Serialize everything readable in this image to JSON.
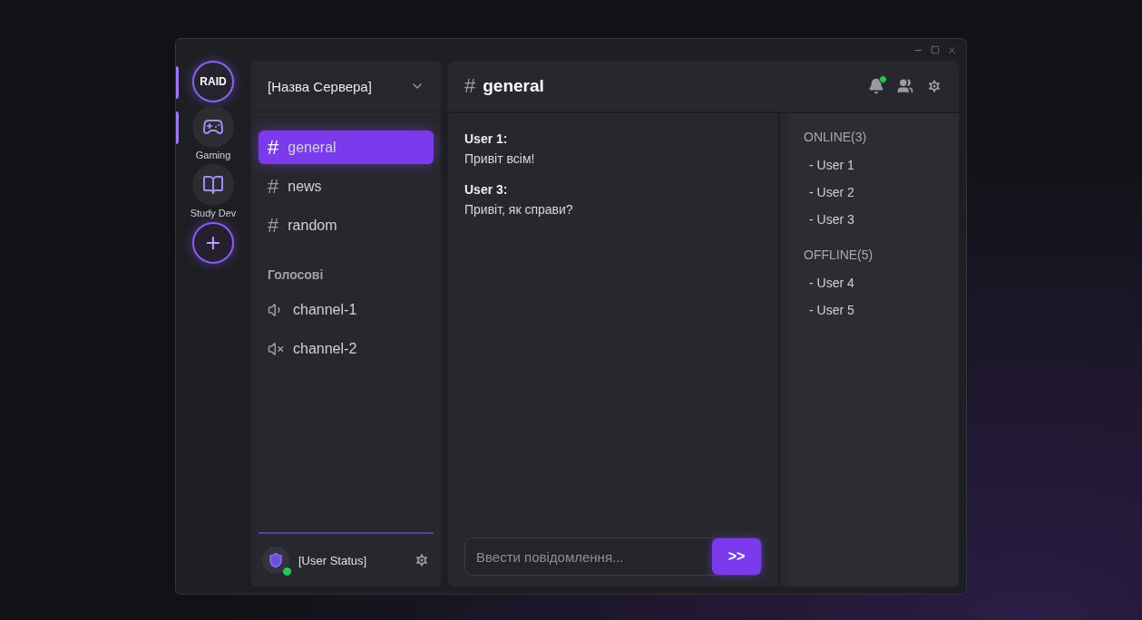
{
  "servers": [
    {
      "kind": "logo",
      "label": "RAID",
      "pill": true
    },
    {
      "kind": "gamepad",
      "label": "Gaming",
      "pill": true
    },
    {
      "kind": "book",
      "label": "Study Dev",
      "pill": false
    },
    {
      "kind": "add",
      "label": "+",
      "pill": false
    }
  ],
  "server_name": "[Назва Сервера]",
  "channels": [
    {
      "kind": "text",
      "symbol": "#",
      "name": "general",
      "selected": true
    },
    {
      "kind": "text",
      "symbol": "#",
      "name": "news",
      "selected": false
    },
    {
      "kind": "text",
      "symbol": "#",
      "name": "random",
      "selected": false
    },
    {
      "kind": "heading",
      "name": "Голосові"
    },
    {
      "kind": "voice",
      "name": "channel-1",
      "muted": false
    },
    {
      "kind": "voice",
      "name": "channel-2",
      "muted": true
    }
  ],
  "user": {
    "status": "[User Status]",
    "online": true
  },
  "header": {
    "symbol": "#",
    "title": "general",
    "notification": true
  },
  "messages": [
    {
      "author": "User 1:",
      "text": "Привіт всім!"
    },
    {
      "author": "User 3:",
      "text": "Привіт, як справи?"
    }
  ],
  "composer": {
    "placeholder": "Ввести повідомлення...",
    "send": ">>"
  },
  "members": [
    {
      "heading": "ONLINE(3)",
      "users": [
        "- User 1",
        "- User 2",
        "- User 3"
      ]
    },
    {
      "heading": "OFFLINE(5)",
      "users": [
        "- User 4",
        "- User 5"
      ]
    }
  ]
}
